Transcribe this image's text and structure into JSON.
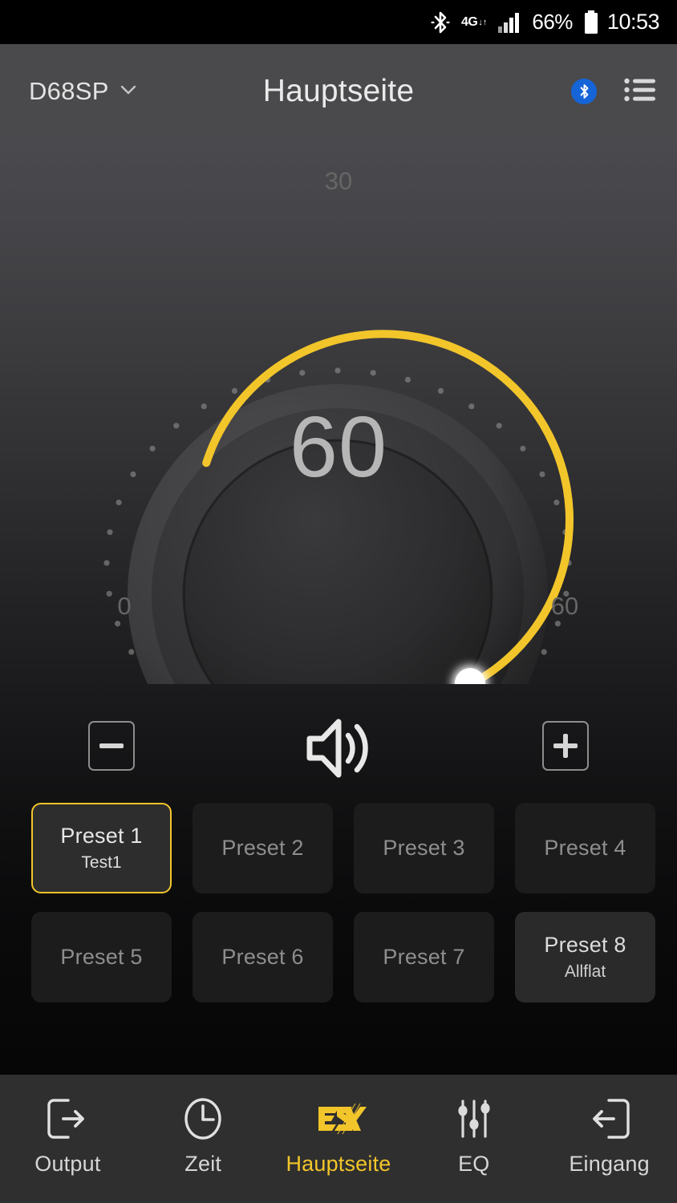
{
  "status_bar": {
    "bluetooth_icon": "bluetooth-icon",
    "network_type": "4G",
    "network_arrows": "↓↑",
    "signal_icon": "signal-bars-icon",
    "battery_percent": "66%",
    "battery_icon": "battery-icon",
    "time": "10:53"
  },
  "header": {
    "device_name": "D68SP",
    "device_chevron": "chevron-down-icon",
    "title": "Hauptseite",
    "bluetooth_badge": "bluetooth-icon",
    "menu_icon": "list-menu-icon"
  },
  "dial": {
    "value": "60",
    "label_min": "0",
    "label_mid": "30",
    "label_max": "60",
    "min": 0,
    "max": 60,
    "current": 60,
    "accent_color": "#F2C52A",
    "handle_color": "#FFFFFF"
  },
  "volume": {
    "minus_label": "−",
    "plus_label": "+",
    "speaker_icon": "speaker-volume-icon"
  },
  "presets": [
    {
      "name": "Preset 1",
      "sub": "Test1",
      "state": "active"
    },
    {
      "name": "Preset 2",
      "sub": "",
      "state": "empty"
    },
    {
      "name": "Preset 3",
      "sub": "",
      "state": "empty"
    },
    {
      "name": "Preset 4",
      "sub": "",
      "state": "empty"
    },
    {
      "name": "Preset 5",
      "sub": "",
      "state": "empty"
    },
    {
      "name": "Preset 6",
      "sub": "",
      "state": "empty"
    },
    {
      "name": "Preset 7",
      "sub": "",
      "state": "empty"
    },
    {
      "name": "Preset 8",
      "sub": "Allflat",
      "state": "filled"
    }
  ],
  "nav": [
    {
      "label": "Output",
      "icon": "arrow-out-box-icon",
      "active": false
    },
    {
      "label": "Zeit",
      "icon": "clock-icon",
      "active": false
    },
    {
      "label": "Hauptseite",
      "icon": "esx-logo-icon",
      "active": true
    },
    {
      "label": "EQ",
      "icon": "equalizer-icon",
      "active": false
    },
    {
      "label": "Eingang",
      "icon": "arrow-in-box-icon",
      "active": false
    }
  ],
  "colors": {
    "accent": "#F2C52A",
    "bluetooth_blue": "#1565D8",
    "header_bg": "#4A4A4C",
    "nav_bg": "#2F2F2F",
    "preset_bg": "#1C1C1C"
  }
}
